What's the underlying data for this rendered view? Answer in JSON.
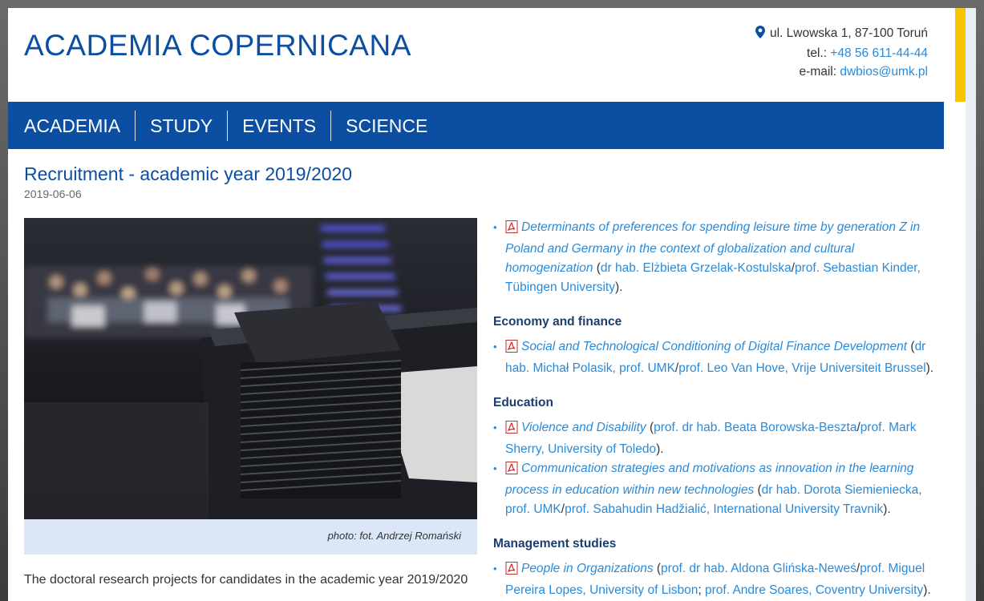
{
  "site": {
    "title": "ACADEMIA COPERNICANA"
  },
  "contact": {
    "address": "ul. Lwowska 1, 87-100 Toruń",
    "tel_label": "tel.:",
    "tel": "+48 56 611-44-44",
    "email_label": "e-mail:",
    "email": "dwbios@umk.pl"
  },
  "nav": {
    "items": [
      "ACADEMIA",
      "STUDY",
      "EVENTS",
      "SCIENCE"
    ]
  },
  "article": {
    "title": "Recruitment - academic year 2019/2020",
    "date": "2019-06-06",
    "caption": "photo: fot. Andrzej Romański",
    "intro": "The doctoral research projects for candidates in the academic year 2019/2020"
  },
  "projects": {
    "top": {
      "title": "Determinants of preferences for spending leisure time by generation Z in Poland and Germany in the context of globalization and cultural homogenization",
      "sup1": "dr hab. Elżbieta Grzelak-Kostulska",
      "sup2": "prof. Sebastian Kinder, Tübingen University"
    },
    "economy": {
      "heading": "Economy and finance",
      "items": [
        {
          "title": "Social and Technological Conditioning of Digital Finance Development",
          "sup1": "dr hab. Michał Polasik, prof. UMK",
          "sup2": "prof. Leo Van Hove, Vrije Universiteit Brussel"
        }
      ]
    },
    "education": {
      "heading": "Education",
      "items": [
        {
          "title": "Violence and Disability",
          "sup1": "prof. dr hab. Beata Borowska-Beszta",
          "sup2": "prof. Mark Sherry, University of Toledo"
        },
        {
          "title": "Communication strategies and motivations as innovation in the learning process in education within new technologies",
          "sup1": "dr hab. Dorota Siemieniecka, prof. UMK",
          "sup2": "prof. Sabahudin Hadžialić, International University Travnik"
        }
      ]
    },
    "management": {
      "heading": "Management studies",
      "items": [
        {
          "title": "People in Organizations",
          "sup1": "prof. dr hab. Aldona Glińska-Neweś",
          "sup2": "prof. Miguel Pereira Lopes, University of Lisbon",
          "sup3": "prof. Andre Soares, Coventry University"
        }
      ]
    }
  },
  "colors": {
    "brand_blue": "#0b4ea2",
    "link_blue": "#2a8ad8",
    "accent_yellow": "#f6c400",
    "caption_bg": "#dbe6f6"
  }
}
